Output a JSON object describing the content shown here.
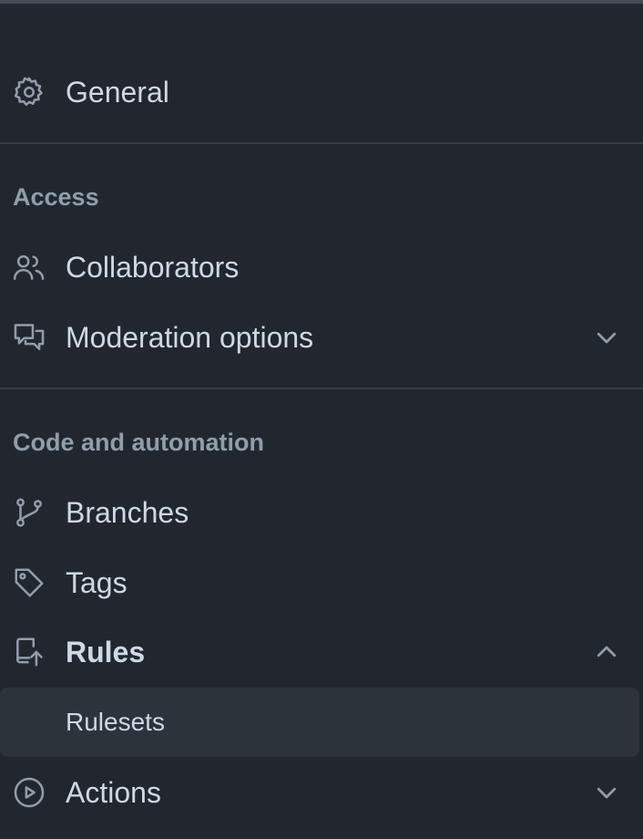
{
  "general": {
    "label": "General",
    "icon": "gear-icon"
  },
  "sections": {
    "access": {
      "heading": "Access",
      "items": [
        {
          "label": "Collaborators",
          "icon": "people-icon"
        },
        {
          "label": "Moderation options",
          "icon": "comment-discussion-icon",
          "expandable": true,
          "expanded": false
        }
      ]
    },
    "code_automation": {
      "heading": "Code and automation",
      "items": [
        {
          "label": "Branches",
          "icon": "git-branch-icon"
        },
        {
          "label": "Tags",
          "icon": "tag-icon"
        },
        {
          "label": "Rules",
          "icon": "repo-push-icon",
          "expandable": true,
          "expanded": true,
          "subitems": [
            {
              "label": "Rulesets"
            }
          ]
        },
        {
          "label": "Actions",
          "icon": "play-icon",
          "expandable": true,
          "expanded": false
        }
      ]
    }
  },
  "colors": {
    "background": "#22272e",
    "text": "#cdd9e5",
    "muted": "#909dab",
    "divider": "#373e47",
    "selected_bg": "#2d333b"
  }
}
